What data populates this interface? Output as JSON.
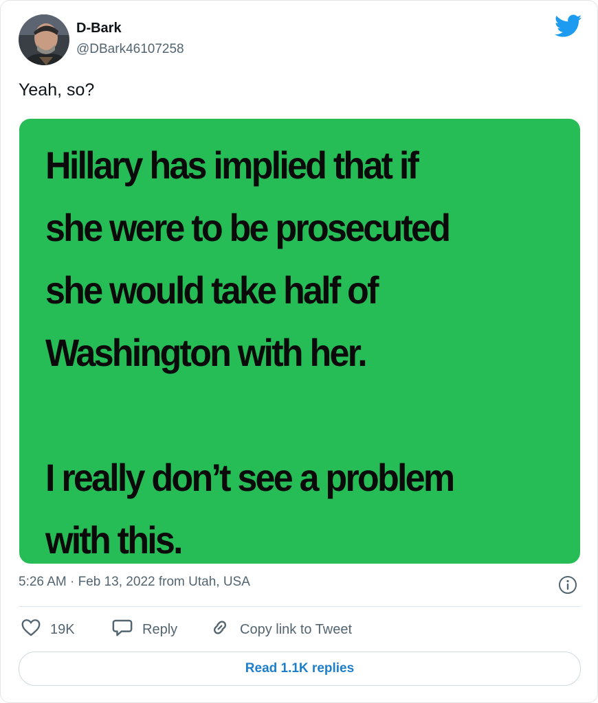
{
  "user": {
    "display_name": "D-Bark",
    "handle": "@DBark46107258"
  },
  "tweet": {
    "text": "Yeah, so?",
    "image_text": {
      "line1": "Hillary has implied that if",
      "line2": "she were to be prosecuted",
      "line3": "she would take half of",
      "line4": "Washington with her.",
      "line5": "I really don’t see a problem",
      "line6": "with this."
    },
    "timestamp": "5:26 AM · Feb 13, 2022 from Utah, USA"
  },
  "actions": {
    "like_count": "19K",
    "reply_label": "Reply",
    "copy_label": "Copy link to Tweet"
  },
  "read_replies_label": "Read 1.1K replies",
  "colors": {
    "media_background": "#26bd57",
    "twitter_blue": "#1d9bf0",
    "link_blue": "#1d7ecc"
  },
  "icons": [
    "twitter-bird-icon",
    "info-icon",
    "heart-icon",
    "reply-bubble-icon",
    "link-icon"
  ]
}
